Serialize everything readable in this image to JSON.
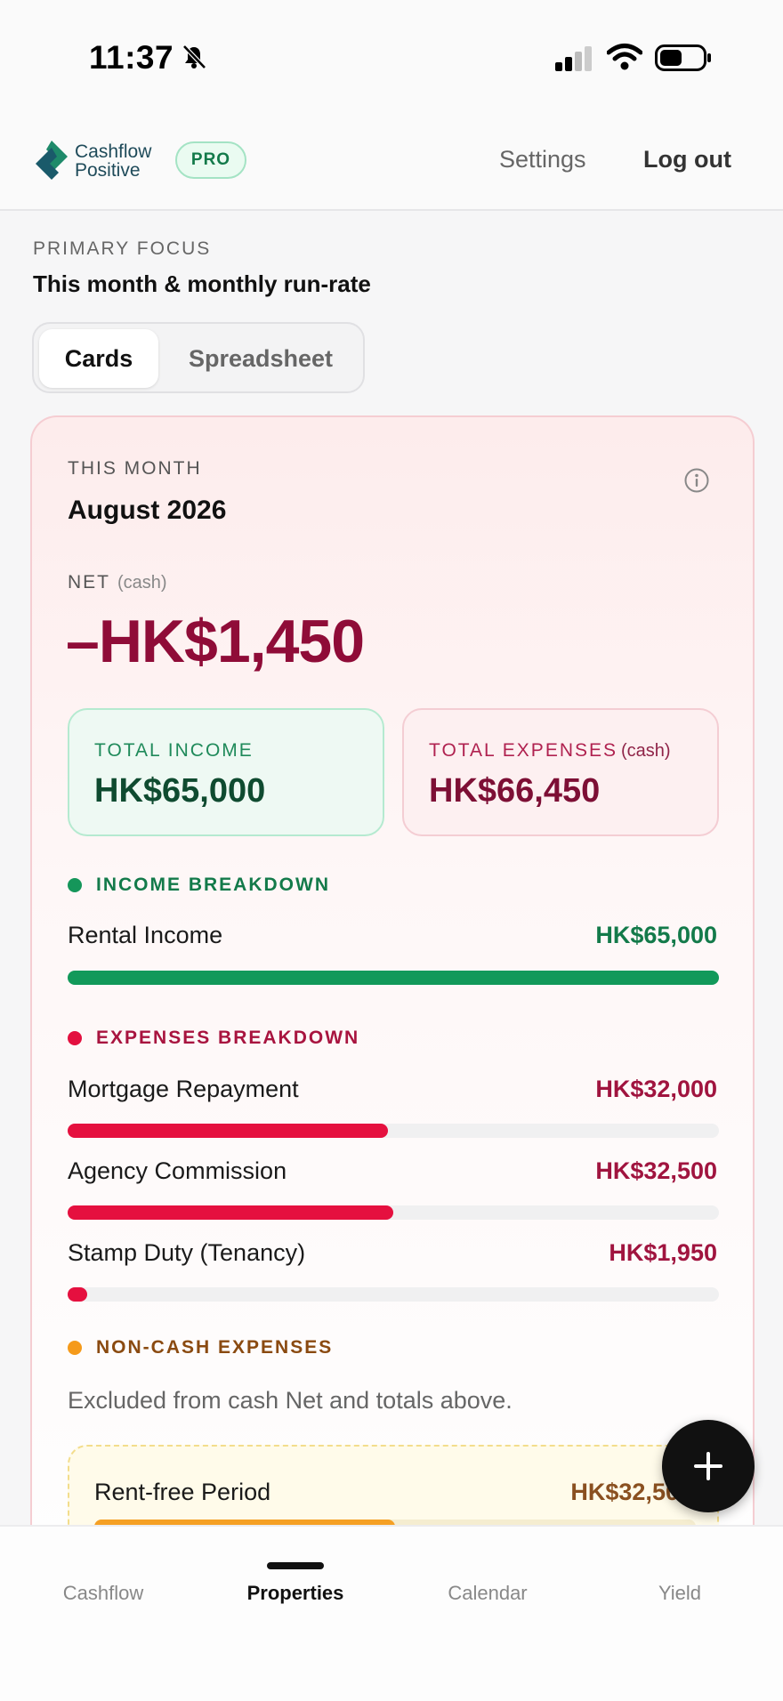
{
  "status_bar": {
    "time": "11:37"
  },
  "header": {
    "logo_line1": "Cashflow",
    "logo_line2": "Positive",
    "badge": "PRO",
    "settings": "Settings",
    "logout": "Log out",
    "brand_color": "#1f7a5a"
  },
  "focus": {
    "label": "PRIMARY FOCUS",
    "value": "This month & monthly run-rate"
  },
  "view_toggle": {
    "options": [
      "Cards",
      "Spreadsheet"
    ],
    "selected": "Cards"
  },
  "summary": {
    "month_label": "THIS MONTH",
    "month_value": "August 2026",
    "net_label": "NET",
    "net_sub": "(cash)",
    "net_value": "–HK$1,450",
    "income_label": "TOTAL INCOME",
    "income_value": "HK$65,000",
    "expenses_label": "TOTAL EXPENSES",
    "expenses_sub": "(cash)",
    "expenses_value": "HK$66,450"
  },
  "income_breakdown": {
    "title": "INCOME BREAKDOWN",
    "items": [
      {
        "label": "Rental Income",
        "value": "HK$65,000",
        "fraction": 1.0
      }
    ]
  },
  "expenses_breakdown": {
    "title": "EXPENSES BREAKDOWN",
    "items": [
      {
        "label": "Mortgage Repayment",
        "value": "HK$32,000",
        "fraction": 0.492
      },
      {
        "label": "Agency Commission",
        "value": "HK$32,500",
        "fraction": 0.5
      },
      {
        "label": "Stamp Duty (Tenancy)",
        "value": "HK$1,950",
        "fraction": 0.03
      }
    ]
  },
  "non_cash": {
    "title": "NON-CASH EXPENSES",
    "note": "Excluded from cash Net and totals above.",
    "items": [
      {
        "label": "Rent-free Period",
        "value": "HK$32,500",
        "fraction": 0.5
      }
    ]
  },
  "tabs": [
    "Cashflow",
    "Properties",
    "Calendar",
    "Yield"
  ],
  "active_tab": "Properties",
  "colors": {
    "income": "#12995a",
    "expense": "#e5103f",
    "noncash": "#f5a024",
    "net_negative": "#8f0c38"
  },
  "icons": [
    "bell-slash-icon",
    "signal-icon",
    "wifi-icon",
    "battery-icon",
    "info-icon",
    "plus-icon"
  ]
}
